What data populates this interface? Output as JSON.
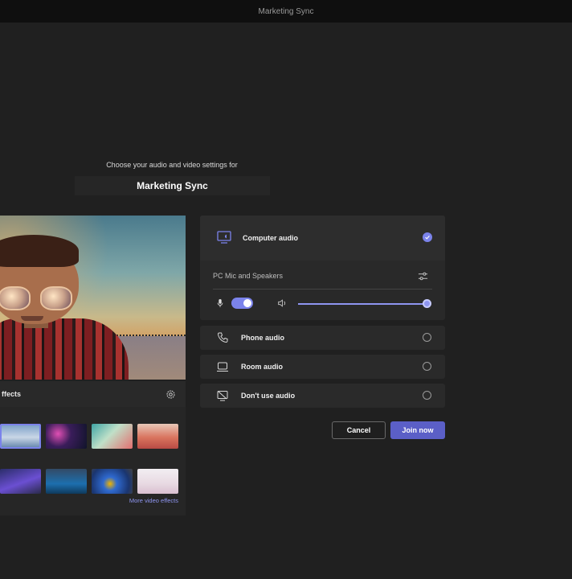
{
  "window": {
    "title": "Marketing Sync"
  },
  "prejoin": {
    "subtitle": "Choose your audio and video settings for",
    "meeting_name": "Marketing Sync"
  },
  "video": {
    "effects_label": "ffects",
    "more_effects_link": "More video effects"
  },
  "audio": {
    "computer_audio": {
      "label": "Computer audio",
      "selected": true,
      "device_label": "PC Mic and Speakers",
      "mic_on": true,
      "speaker_volume_fraction": 1.0
    },
    "options": [
      {
        "label": "Phone audio",
        "icon": "phone-icon",
        "selected": false
      },
      {
        "label": "Room audio",
        "icon": "room-device-icon",
        "selected": false
      },
      {
        "label": "Don't use audio",
        "icon": "no-audio-icon",
        "selected": false
      }
    ]
  },
  "actions": {
    "cancel_label": "Cancel",
    "join_label": "Join now"
  },
  "colors": {
    "accent": "#5b5fc7",
    "accent_light": "#7b83eb",
    "background": "#202020",
    "panel": "#292929"
  }
}
